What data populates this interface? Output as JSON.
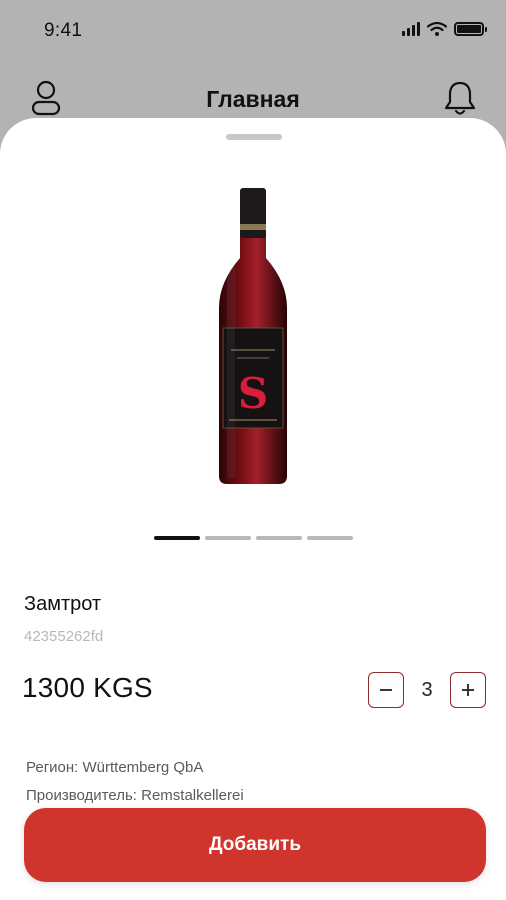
{
  "status_bar": {
    "time": "9:41"
  },
  "header": {
    "title": "Главная"
  },
  "product": {
    "name": "Замтрот",
    "sku": "42355262fd",
    "price": "1300 KGS",
    "quantity": "3",
    "details": {
      "region": "Регион: Württemberg QbA",
      "producer": "Производитель: Remstalkellerei"
    },
    "image_count": 4,
    "active_image": 1
  },
  "actions": {
    "add_label": "Добавить"
  },
  "colors": {
    "accent": "#d0352d",
    "stepper_border": "#8e2b2b",
    "backdrop": "#b3b3b3"
  },
  "icons": [
    "profile-icon",
    "bell-icon",
    "minus-icon",
    "plus-icon",
    "wine-bottle-image"
  ]
}
